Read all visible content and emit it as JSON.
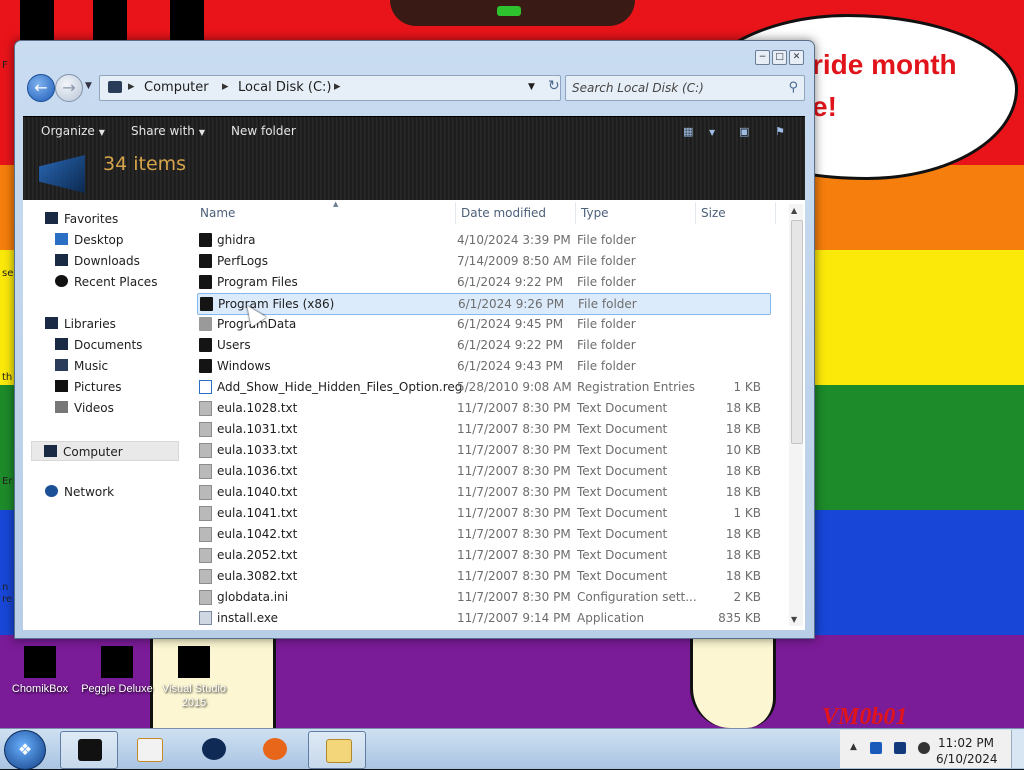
{
  "desktop": {
    "speech_line1": "ride month",
    "speech_line2": "e!",
    "vm_label": "VM0b01",
    "edge_text": [
      "F",
      "se",
      "th",
      "Er",
      "n re"
    ],
    "icons": [
      {
        "label": "ChomikBox"
      },
      {
        "label": "Peggle Deluxe"
      },
      {
        "label": "Visual Studio 2015"
      }
    ]
  },
  "window": {
    "controls": {
      "minimize": "−",
      "maximize": "□",
      "close": "✕"
    },
    "breadcrumb": [
      "Computer",
      "Local Disk (C:)"
    ],
    "search_placeholder": "Search Local Disk (C:)",
    "toolbar": {
      "organize": "Organize",
      "share_with": "Share with",
      "new_folder": "New folder"
    },
    "items_count": "34 items",
    "nav": {
      "favorites": "Favorites",
      "desktop": "Desktop",
      "downloads": "Downloads",
      "recent_places": "Recent Places",
      "libraries": "Libraries",
      "documents": "Documents",
      "music": "Music",
      "pictures": "Pictures",
      "videos": "Videos",
      "computer": "Computer",
      "network": "Network"
    },
    "columns": {
      "name": "Name",
      "date": "Date modified",
      "type": "Type",
      "size": "Size"
    },
    "files": [
      {
        "name": "ghidra",
        "date": "4/10/2024 3:39 PM",
        "type": "File folder",
        "size": "",
        "icon": "folder"
      },
      {
        "name": "PerfLogs",
        "date": "7/14/2009 8:50 AM",
        "type": "File folder",
        "size": "",
        "icon": "folder"
      },
      {
        "name": "Program Files",
        "date": "6/1/2024 9:22 PM",
        "type": "File folder",
        "size": "",
        "icon": "folder"
      },
      {
        "name": "Program Files (x86)",
        "date": "6/1/2024 9:26 PM",
        "type": "File folder",
        "size": "",
        "icon": "folder"
      },
      {
        "name": "ProgramData",
        "date": "6/1/2024 9:45 PM",
        "type": "File folder",
        "size": "",
        "icon": "folder-light"
      },
      {
        "name": "Users",
        "date": "6/1/2024 9:22 PM",
        "type": "File folder",
        "size": "",
        "icon": "folder"
      },
      {
        "name": "Windows",
        "date": "6/1/2024 9:43 PM",
        "type": "File folder",
        "size": "",
        "icon": "folder"
      },
      {
        "name": "Add_Show_Hide_Hidden_Files_Option.reg",
        "date": "5/28/2010 9:08 AM",
        "type": "Registration Entries",
        "size": "1 KB",
        "icon": "reg"
      },
      {
        "name": "eula.1028.txt",
        "date": "11/7/2007 8:30 PM",
        "type": "Text Document",
        "size": "18 KB",
        "icon": "doc"
      },
      {
        "name": "eula.1031.txt",
        "date": "11/7/2007 8:30 PM",
        "type": "Text Document",
        "size": "18 KB",
        "icon": "doc"
      },
      {
        "name": "eula.1033.txt",
        "date": "11/7/2007 8:30 PM",
        "type": "Text Document",
        "size": "10 KB",
        "icon": "doc"
      },
      {
        "name": "eula.1036.txt",
        "date": "11/7/2007 8:30 PM",
        "type": "Text Document",
        "size": "18 KB",
        "icon": "doc"
      },
      {
        "name": "eula.1040.txt",
        "date": "11/7/2007 8:30 PM",
        "type": "Text Document",
        "size": "18 KB",
        "icon": "doc"
      },
      {
        "name": "eula.1041.txt",
        "date": "11/7/2007 8:30 PM",
        "type": "Text Document",
        "size": "1 KB",
        "icon": "doc"
      },
      {
        "name": "eula.1042.txt",
        "date": "11/7/2007 8:30 PM",
        "type": "Text Document",
        "size": "18 KB",
        "icon": "doc"
      },
      {
        "name": "eula.2052.txt",
        "date": "11/7/2007 8:30 PM",
        "type": "Text Document",
        "size": "18 KB",
        "icon": "doc"
      },
      {
        "name": "eula.3082.txt",
        "date": "11/7/2007 8:30 PM",
        "type": "Text Document",
        "size": "18 KB",
        "icon": "doc"
      },
      {
        "name": "globdata.ini",
        "date": "11/7/2007 8:30 PM",
        "type": "Configuration sett...",
        "size": "2 KB",
        "icon": "doc"
      },
      {
        "name": "install.exe",
        "date": "11/7/2007 9:14 PM",
        "type": "Application",
        "size": "835 KB",
        "icon": "exe"
      }
    ],
    "selected_row": 3
  },
  "taskbar": {
    "clock_time": "11:02 PM",
    "clock_date": "6/10/2024"
  },
  "colors": {
    "accent": "#1e5cb8",
    "selection": "#dcebfc",
    "flag_red": "#e8141a",
    "flag_orange": "#f57e0c",
    "flag_yellow": "#fbe90a",
    "flag_green": "#1d8b2a",
    "flag_blue": "#1847d8",
    "flag_purple": "#7a1b97"
  }
}
